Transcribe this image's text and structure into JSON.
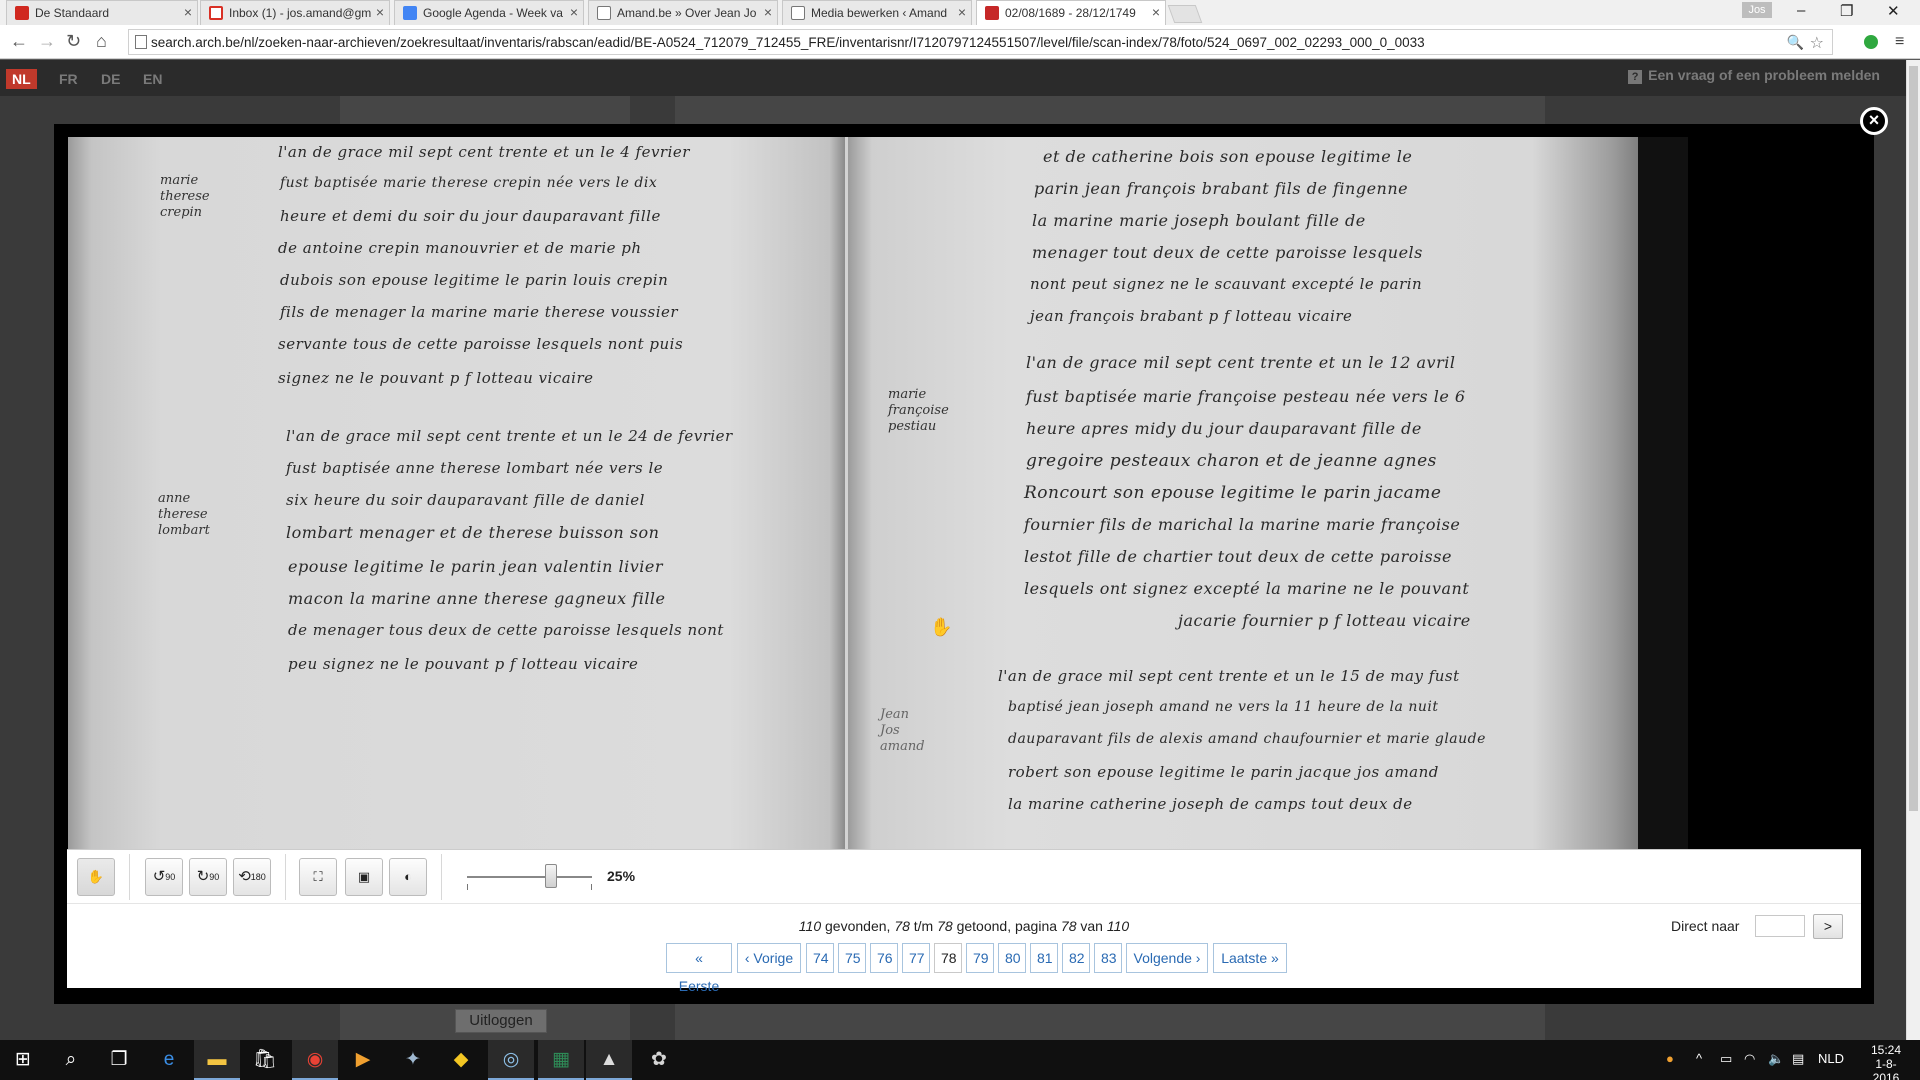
{
  "browser": {
    "tabs": [
      {
        "title": "De Standaard",
        "favicon_color": "#d0281f",
        "active": false
      },
      {
        "title": "Inbox (1) - jos.amand@gm",
        "favicon_color": "#d93025",
        "active": false
      },
      {
        "title": "Google Agenda - Week va",
        "favicon_color": "#4285f4",
        "active": false
      },
      {
        "title": "Amand.be » Over Jean Jo",
        "favicon_color": "#777777",
        "active": false
      },
      {
        "title": "Media bewerken ‹ Amand",
        "favicon_color": "#777777",
        "active": false
      },
      {
        "title": "02/08/1689 - 28/12/1749",
        "favicon_color": "#c62828",
        "active": true
      }
    ],
    "profile_label": "Jos",
    "url": "search.arch.be/nl/zoeken-naar-archieven/zoekresultaat/inventaris/rabscan/eadid/BE-A0524_712079_712455_FRE/inventarisnr/I7120797124551507/level/file/scan-index/78/foto/524_0697_002_02293_000_0_0033"
  },
  "site": {
    "languages": [
      "NL",
      "FR",
      "DE",
      "EN"
    ],
    "active_language": "NL",
    "help_text": "Een vraag of een probleem melden",
    "logout_label": "Uitloggen"
  },
  "viewer": {
    "margin_notes": {
      "left_1": [
        "marie",
        "therese",
        "crepin"
      ],
      "left_2": [
        "anne",
        "therese",
        "lombart"
      ],
      "right_1": [
        "marie",
        "françoise",
        "pestiau"
      ],
      "right_2": [
        "Jean",
        "Jos",
        "amand"
      ]
    },
    "left_page_lines": [
      "l'an de grace mil sept cent trente et un le 4 fevrier",
      "fust baptisée marie therese crepin née vers le dix",
      "heure et demi du soir du jour dauparavant fille",
      "de antoine crepin manouvrier et de marie ph",
      "dubois son epouse legitime le parin louis crepin",
      "fils de menager la marine marie therese voussier",
      "servante tous de cette paroisse lesquels nont puis",
      "signez ne le pouvant          p f lotteau vicaire",
      "l'an de grace mil sept cent trente et un le 24 de fevrier",
      "fust baptisée anne therese lombart née vers le",
      "six heure du soir dauparavant fille de daniel",
      "lombart menager et de therese buisson son",
      "epouse legitime le parin jean valentin livier",
      "macon la marine anne therese gagneux fille",
      "de menager tous deux de cette paroisse lesquels nont",
      "peu signez ne le pouvant     p f lotteau vicaire"
    ],
    "right_page_lines": [
      "et de catherine bois son epouse legitime le",
      "parin jean françois brabant fils de fingenne",
      "la marine marie joseph boulant fille de",
      "menager tout deux de cette paroisse lesquels",
      "nont peut signez ne le scauvant excepté le parin",
      "jean françois brabant          p f lotteau vicaire",
      "l'an de grace mil sept cent trente et un le 12 avril",
      "fust baptisée marie françoise pesteau née vers le 6",
      "heure apres midy du jour dauparavant fille de",
      "gregoire pesteaux charon et de jeanne agnes",
      "Roncourt son epouse legitime le parin jacame",
      "fournier fils de marichal la marine marie françoise",
      "lestot fille de chartier tout deux de cette paroisse",
      "lesquels ont signez excepté la marine ne le pouvant",
      "jacarie fournier        p f lotteau vicaire",
      "l'an de grace mil sept cent trente et un le 15 de may fust",
      "baptisé jean joseph amand ne vers la 11 heure de la nuit",
      "dauparavant fils de alexis amand chaufournier et marie glaude",
      "robert son epouse legitime le parin jacque jos amand",
      "la marine catherine joseph de camps tout deux de"
    ],
    "toolbar": {
      "rotate_left_label": "90",
      "rotate_right_label": "90",
      "rotate_180_label": "180",
      "zoom": "25%"
    },
    "pagination": {
      "found_count": "110",
      "found_label": "gevonden,",
      "shown_from": "78",
      "tm_label": "t/m",
      "shown_to": "78",
      "shown_label": "getoond, pagina",
      "page": "78",
      "of_label": "van",
      "total_pages": "110",
      "first_label": "« Eerste",
      "prev_label": "‹ Vorige",
      "pages": [
        "74",
        "75",
        "76",
        "77",
        "78",
        "79",
        "80",
        "81",
        "82",
        "83"
      ],
      "current_page": "78",
      "next_label": "Volgende ›",
      "last_label": "Laatste »",
      "direct_label": "Direct naar",
      "go_label": ">"
    }
  },
  "taskbar": {
    "language": "NLD",
    "time": "15:24",
    "date": "1-8-2016"
  }
}
